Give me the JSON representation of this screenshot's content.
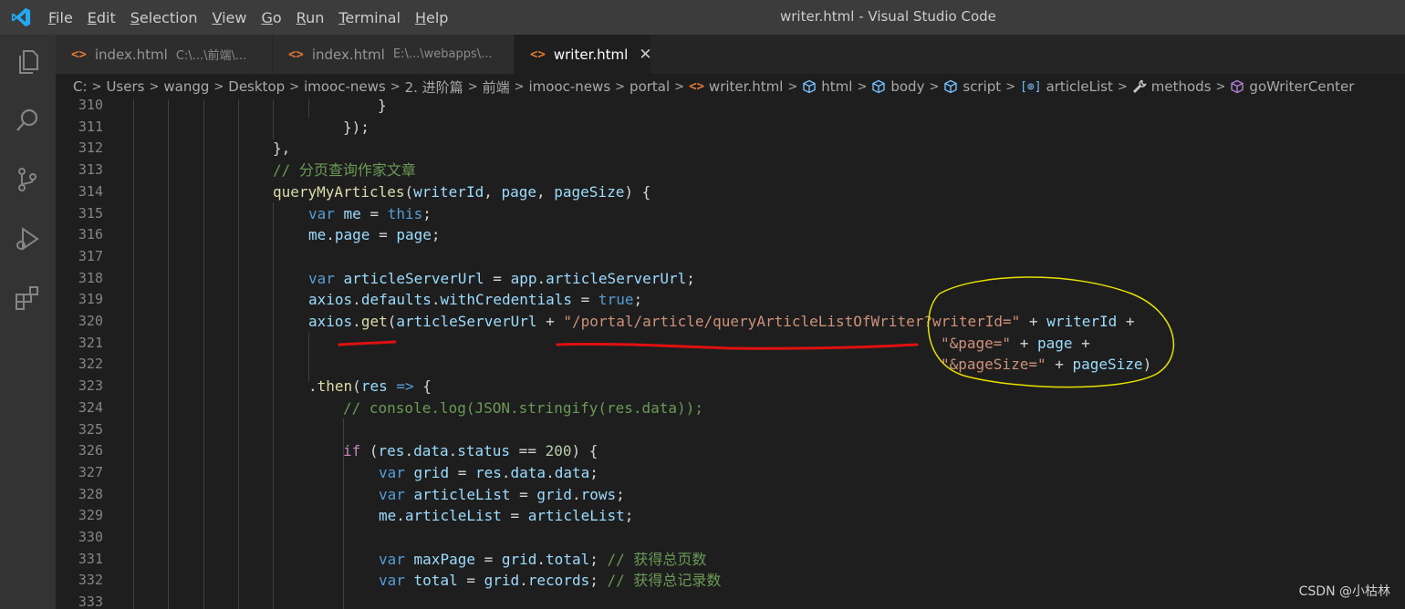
{
  "window": {
    "title": "writer.html - Visual Studio Code",
    "menu": [
      "File",
      "Edit",
      "Selection",
      "View",
      "Go",
      "Run",
      "Terminal",
      "Help"
    ]
  },
  "activity_bar": {
    "icons": [
      "explorer-icon",
      "search-icon",
      "source-control-icon",
      "run-debug-icon",
      "extensions-icon"
    ]
  },
  "tabs": [
    {
      "label": "index.html",
      "path": "C:\\...\\前端\\...",
      "active": false
    },
    {
      "label": "index.html",
      "path": "E:\\...\\webapps\\...",
      "active": false
    },
    {
      "label": "writer.html",
      "path": "",
      "active": true,
      "close": "✕"
    }
  ],
  "breadcrumbs": [
    "C:",
    "Users",
    "wangg",
    "Desktop",
    "imooc-news",
    "2. 进阶篇",
    "前端",
    "imooc-news",
    "portal",
    "writer.html",
    "html",
    "body",
    "script",
    "articleList",
    "methods",
    "goWriterCenter"
  ],
  "editor": {
    "line_numbers": [
      "310",
      "311",
      "312",
      "313",
      "314",
      "315",
      "316",
      "317",
      "318",
      "319",
      "320",
      "321",
      "322",
      "323",
      "324",
      "325",
      "326",
      "327",
      "328",
      "329",
      "330",
      "331",
      "332",
      "333"
    ],
    "lines": {
      "l310_a": "}",
      "l311_a": "});",
      "l312_a": "},",
      "l313_a": "// 分页查询作家文章",
      "l314_fn": "queryMyArticles",
      "l314_p1": "(",
      "l314_v1": "writerId",
      "l314_p2": ", ",
      "l314_v2": "page",
      "l314_p3": ", ",
      "l314_v3": "pageSize",
      "l314_p4": ") {",
      "l315_k": "var",
      "l315_v": " me",
      "l315_p": " = ",
      "l315_k2": "this",
      "l315_p2": ";",
      "l316_v1": "me",
      "l316_p1": ".",
      "l316_v2": "page",
      "l316_p2": " = ",
      "l316_v3": "page",
      "l316_p3": ";",
      "l318_k": "var",
      "l318_v1": " articleServerUrl",
      "l318_p1": " = ",
      "l318_v2": "app",
      "l318_p2": ".",
      "l318_v3": "articleServerUrl",
      "l318_p3": ";",
      "l319_v1": "axios",
      "l319_p1": ".",
      "l319_v2": "defaults",
      "l319_p2": ".",
      "l319_v3": "withCredentials",
      "l319_p3": " = ",
      "l319_k": "true",
      "l319_p4": ";",
      "l320_v1": "axios",
      "l320_p1": ".",
      "l320_fn": "get",
      "l320_p2": "(",
      "l320_v2": "articleServerUrl",
      "l320_p3": " + ",
      "l320_s1": "\"/portal/article/queryArticleListOfWriter?writerId=\"",
      "l320_p4": " + ",
      "l320_v3": "writerId",
      "l320_p5": " +",
      "l321_s": "\"&page=\"",
      "l321_p1": " + ",
      "l321_v": "page",
      "l321_p2": " +",
      "l322_s": "\"&pageSize=\"",
      "l322_p1": " + ",
      "l322_v": "pageSize",
      "l322_p2": ")",
      "l323_p1": ".",
      "l323_fn": "then",
      "l323_p2": "(",
      "l323_v": "res",
      "l323_k": " =>",
      "l323_p3": " {",
      "l324_c": "// console.log(JSON.stringify(res.data));",
      "l326_k": "if",
      "l326_p1": " (",
      "l326_v1": "res",
      "l326_p2": ".",
      "l326_v2": "data",
      "l326_p3": ".",
      "l326_v3": "status",
      "l326_p4": " == ",
      "l326_n": "200",
      "l326_p5": ") {",
      "l327_k": "var",
      "l327_v1": " grid",
      "l327_p1": " = ",
      "l327_v2": "res",
      "l327_p2": ".",
      "l327_v3": "data",
      "l327_p3": ".",
      "l327_v4": "data",
      "l327_p4": ";",
      "l328_k": "var",
      "l328_v1": " articleList",
      "l328_p1": " = ",
      "l328_v2": "grid",
      "l328_p2": ".",
      "l328_v3": "rows",
      "l328_p3": ";",
      "l329_v1": "me",
      "l329_p1": ".",
      "l329_v2": "articleList",
      "l329_p2": " = ",
      "l329_v3": "articleList",
      "l329_p3": ";",
      "l331_k": "var",
      "l331_v1": " maxPage",
      "l331_p1": " = ",
      "l331_v2": "grid",
      "l331_p2": ".",
      "l331_v3": "total",
      "l331_p3": "; ",
      "l331_c": "// 获得总页数",
      "l332_k": "var",
      "l332_v1": " total",
      "l332_p1": " = ",
      "l332_v2": "grid",
      "l332_p2": ".",
      "l332_v3": "records",
      "l332_p3": "; ",
      "l332_c": "// 获得总记录数"
    }
  },
  "watermark": "CSDN @小枯林",
  "colors": {
    "annotation_red": "#e01010",
    "annotation_yellow": "#e8e000"
  }
}
